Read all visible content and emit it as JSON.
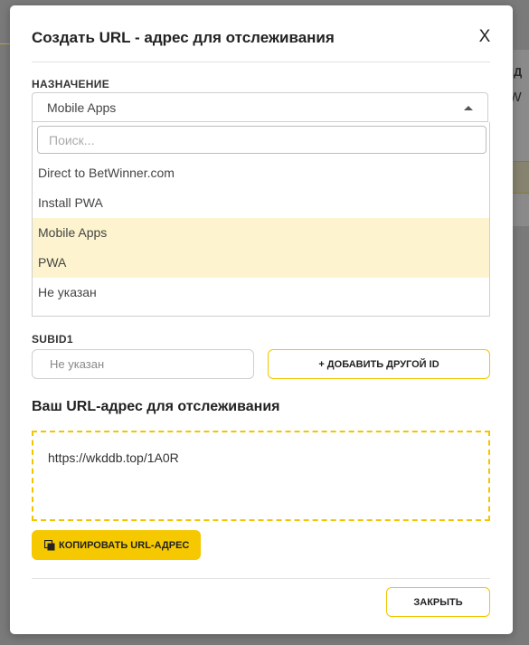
{
  "background": {
    "partial_text_1": "ЕНД",
    "partial_text_2": "etW"
  },
  "modal": {
    "title": "Создать URL - адрес для отслеживания",
    "close_label": "X",
    "purpose": {
      "label": "НАЗНАЧЕНИЕ",
      "selected": "Mobile Apps",
      "search_placeholder": "Поиск...",
      "options": [
        "Direct to BetWinner.com",
        "Install PWA",
        "Mobile Apps",
        "PWA",
        "Не указан"
      ]
    },
    "subid": {
      "label": "SUBID1",
      "placeholder": "Не указан",
      "add_button": "+ ДОБАВИТЬ ДРУГОЙ ID"
    },
    "tracking": {
      "heading": "Ваш URL-адрес для отслеживания",
      "url": "https://wkddb.top/1A0R",
      "copy_button": "КОПИРОВАТЬ URL-АДРЕС"
    },
    "footer": {
      "close_button": "ЗАКРЫТЬ"
    }
  },
  "colors": {
    "accent": "#f5c800",
    "highlight": "#fdf4cf",
    "overlay": "#7a7a7a"
  }
}
